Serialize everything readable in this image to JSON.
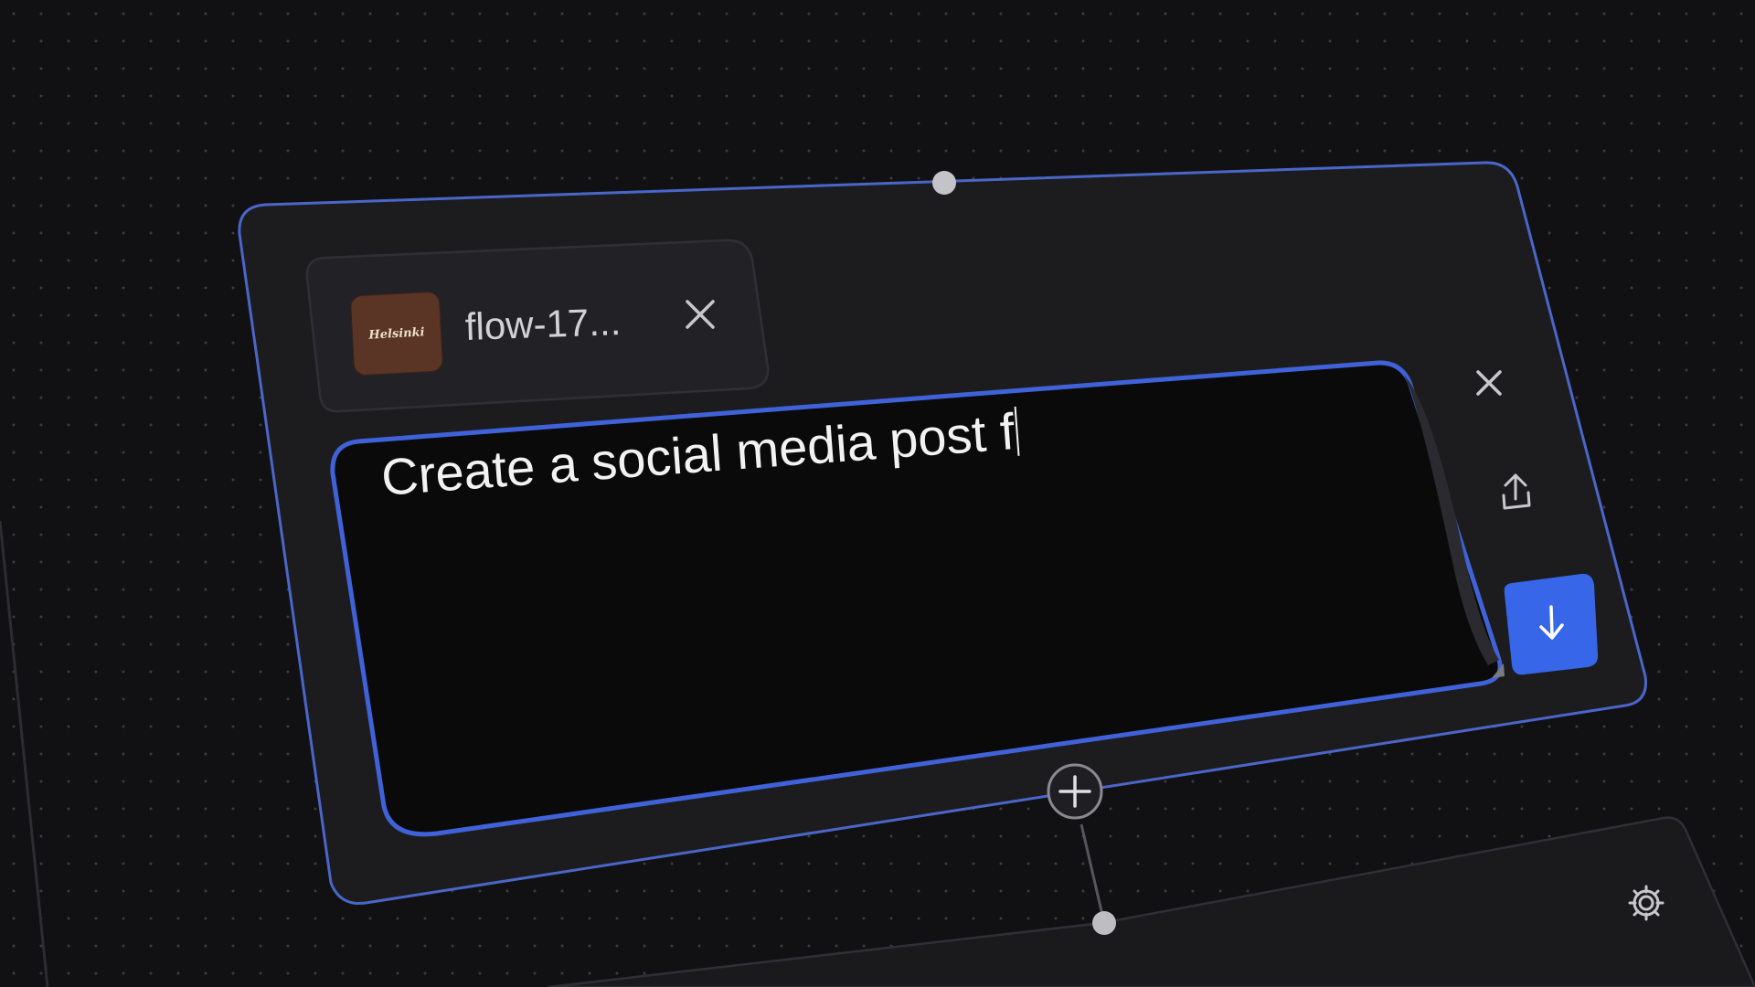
{
  "attachment": {
    "file_name": "flow-17...",
    "thumbnail_text": "Helsinki"
  },
  "prompt": {
    "value": "Create a social media post f"
  },
  "icons": {
    "remove_attachment": "close-icon",
    "close_node": "close-icon",
    "upload": "upload-icon",
    "submit": "arrow-down-icon",
    "add_node": "plus-icon",
    "settings": "gear-icon"
  },
  "colors": {
    "accent": "#3766e8",
    "node_border": "#4a66c8",
    "node_fill": "#1c1c1f",
    "input_fill": "#0a0a0b"
  }
}
